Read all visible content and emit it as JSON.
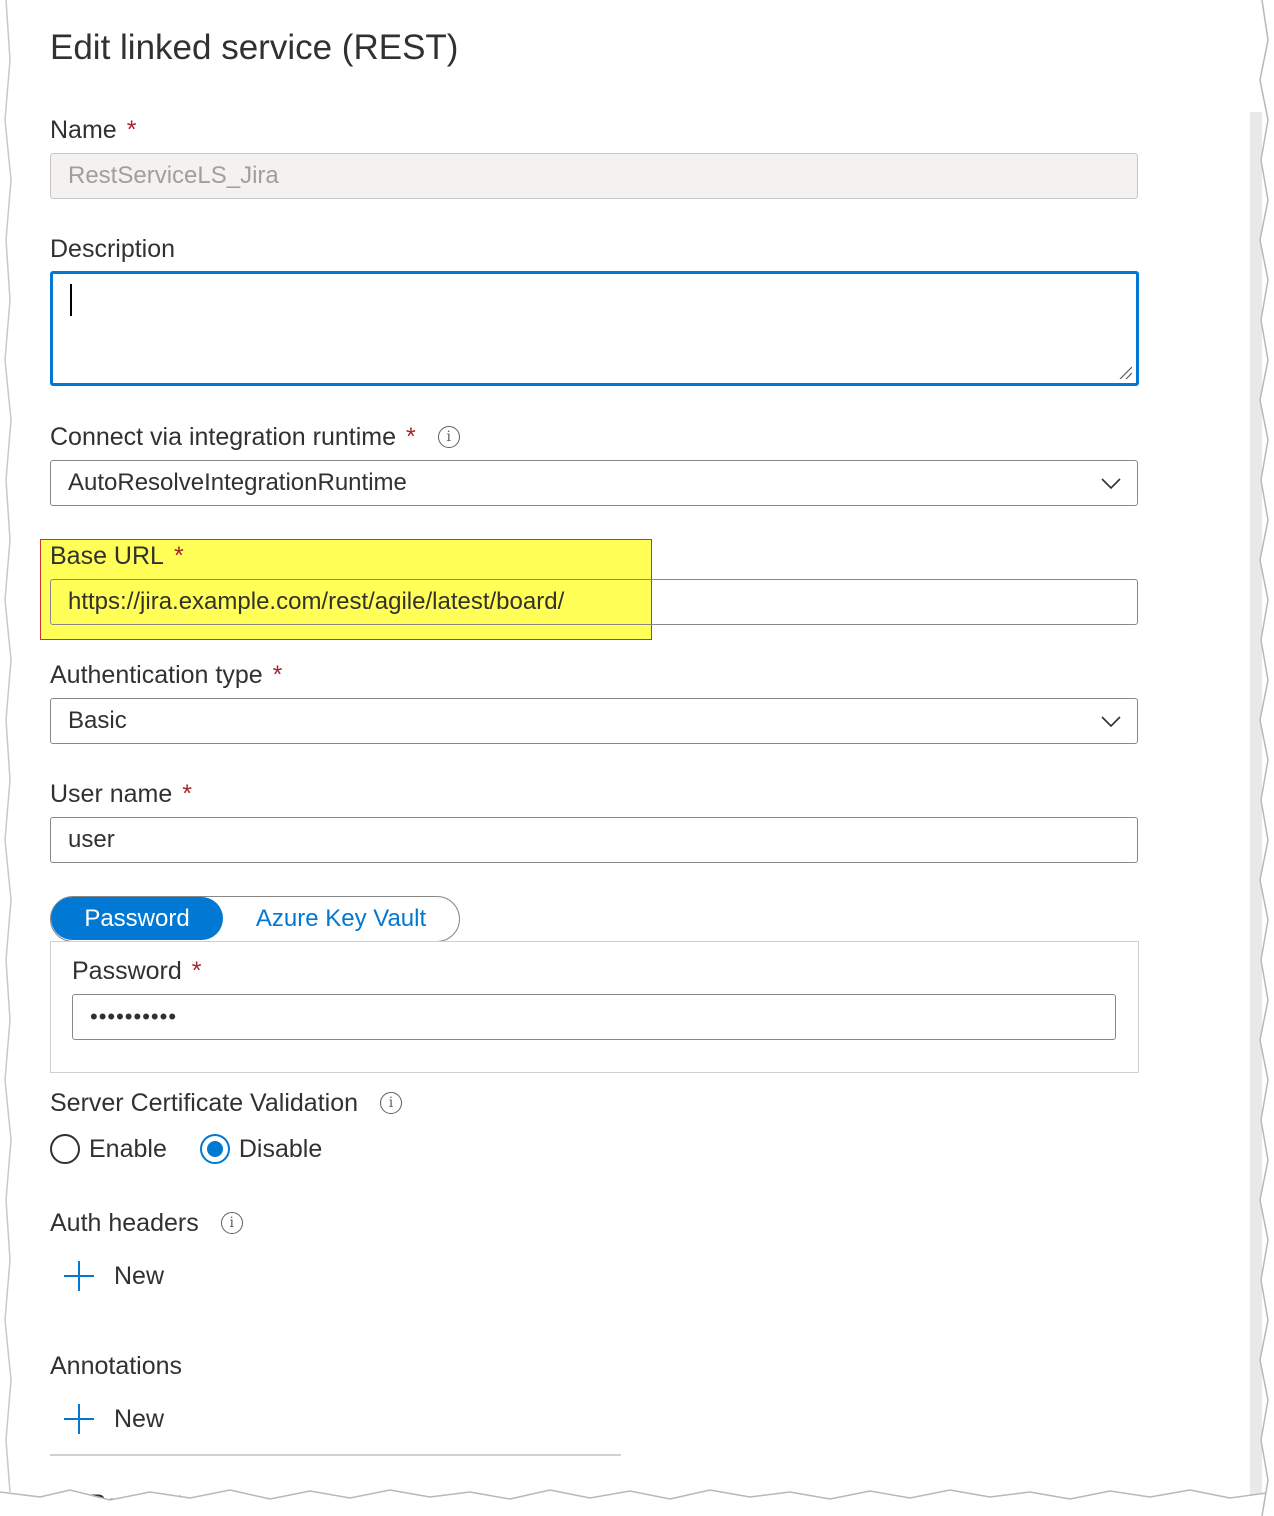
{
  "dialog": {
    "title": "Edit linked service (REST)"
  },
  "required_mark": "*",
  "fields": {
    "name": {
      "label": "Name",
      "value": "RestServiceLS_Jira"
    },
    "description": {
      "label": "Description",
      "value": ""
    },
    "runtime": {
      "label": "Connect via integration runtime",
      "value": "AutoResolveIntegrationRuntime"
    },
    "base_url": {
      "label": "Base URL",
      "value": "https://jira.example.com/rest/agile/latest/board/"
    },
    "auth_type": {
      "label": "Authentication type",
      "value": "Basic"
    },
    "user_name": {
      "label": "User name",
      "value": "user"
    }
  },
  "credential_toggle": {
    "options": [
      "Password",
      "Azure Key Vault"
    ],
    "selected": "Password"
  },
  "password": {
    "label": "Password",
    "masked_value": "••••••••••"
  },
  "cert_validation": {
    "label": "Server Certificate Validation",
    "options": [
      "Enable",
      "Disable"
    ],
    "selected": "Disable"
  },
  "auth_headers": {
    "label": "Auth headers",
    "new_label": "New"
  },
  "annotations": {
    "label": "Annotations",
    "new_label": "New"
  },
  "parameters": {
    "label": "Parameters"
  },
  "colors": {
    "accent": "#0078d4",
    "required": "#a4262c",
    "highlight": "#ffff28",
    "highlight_border": "#d32f2f"
  }
}
